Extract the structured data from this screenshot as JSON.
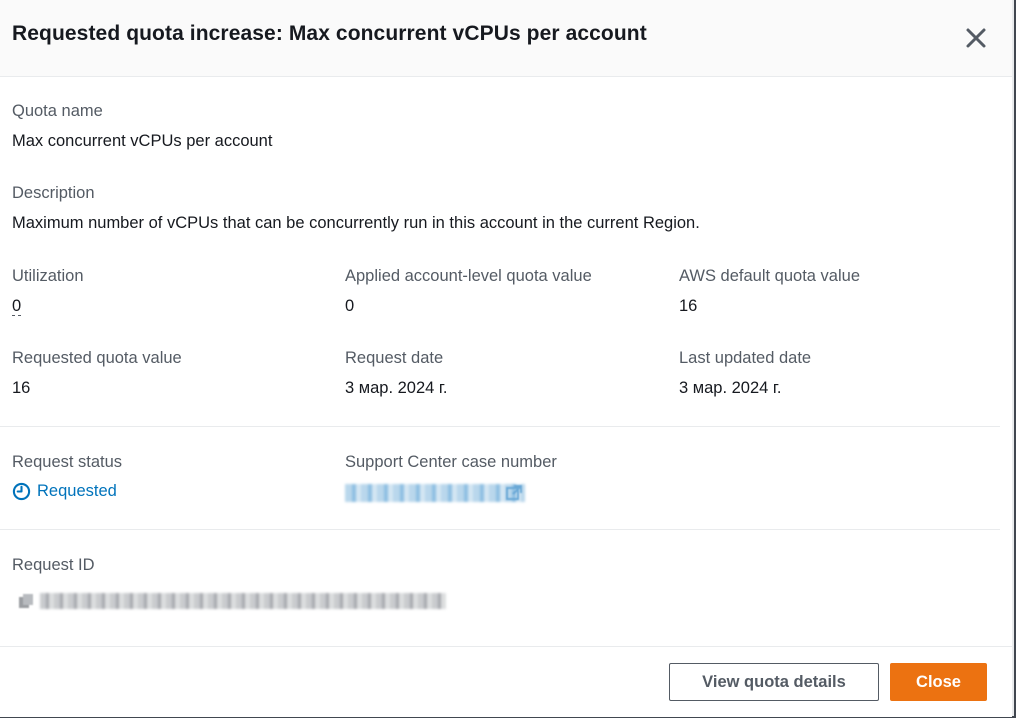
{
  "modal": {
    "title": "Requested quota increase: Max concurrent vCPUs per account",
    "close_icon": "close-icon"
  },
  "fields": {
    "quota_name": {
      "label": "Quota name",
      "value": "Max concurrent vCPUs per account"
    },
    "description": {
      "label": "Description",
      "value": "Maximum number of vCPUs that can be concurrently run in this account in the current Region."
    },
    "utilization": {
      "label": "Utilization",
      "value": "0"
    },
    "applied_value": {
      "label": "Applied account-level quota value",
      "value": "0"
    },
    "default_value": {
      "label": "AWS default quota value",
      "value": "16"
    },
    "requested_value": {
      "label": "Requested quota value",
      "value": "16"
    },
    "request_date": {
      "label": "Request date",
      "value": "3 мар. 2024 г."
    },
    "last_updated": {
      "label": "Last updated date",
      "value": "3 мар. 2024 г."
    },
    "request_status": {
      "label": "Request status",
      "value": "Requested",
      "icon": "clock-icon",
      "color": "#0073bb"
    },
    "support_case": {
      "label": "Support Center case number",
      "icon": "external-link-icon"
    },
    "request_id": {
      "label": "Request ID",
      "icon": "copy-icon"
    }
  },
  "footer": {
    "view_details_label": "View quota details",
    "close_label": "Close"
  },
  "colors": {
    "accent": "#ec7211",
    "link": "#0073bb",
    "label": "#545b64",
    "text": "#16191f"
  }
}
